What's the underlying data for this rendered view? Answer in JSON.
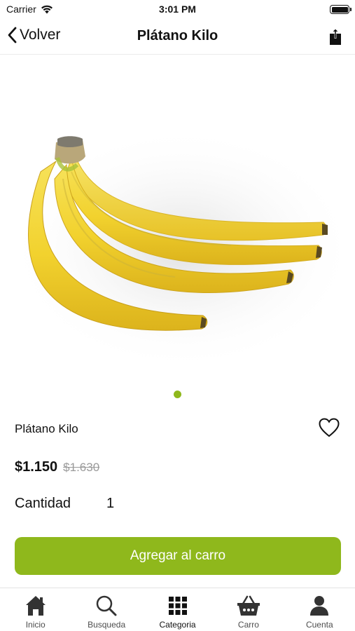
{
  "status_bar": {
    "carrier": "Carrier",
    "time": "3:01 PM"
  },
  "nav": {
    "back_label": "Volver",
    "title": "Plátano Kilo"
  },
  "product": {
    "name": "Plátano Kilo",
    "price_current": "$1.150",
    "price_old": "$1.630",
    "quantity_label": "Cantidad",
    "quantity_value": "1",
    "add_button_label": "Agregar al carro",
    "image_count": 1,
    "current_image": 1
  },
  "tabs": [
    {
      "label": "Inicio",
      "icon": "home-icon"
    },
    {
      "label": "Busqueda",
      "icon": "search-icon"
    },
    {
      "label": "Categoria",
      "icon": "grid-icon",
      "active": true
    },
    {
      "label": "Carro",
      "icon": "basket-icon"
    },
    {
      "label": "Cuenta",
      "icon": "user-icon"
    }
  ],
  "colors": {
    "accent": "#8fb81c",
    "old_price": "#9a9a9a",
    "banana": "#f2d22e"
  }
}
